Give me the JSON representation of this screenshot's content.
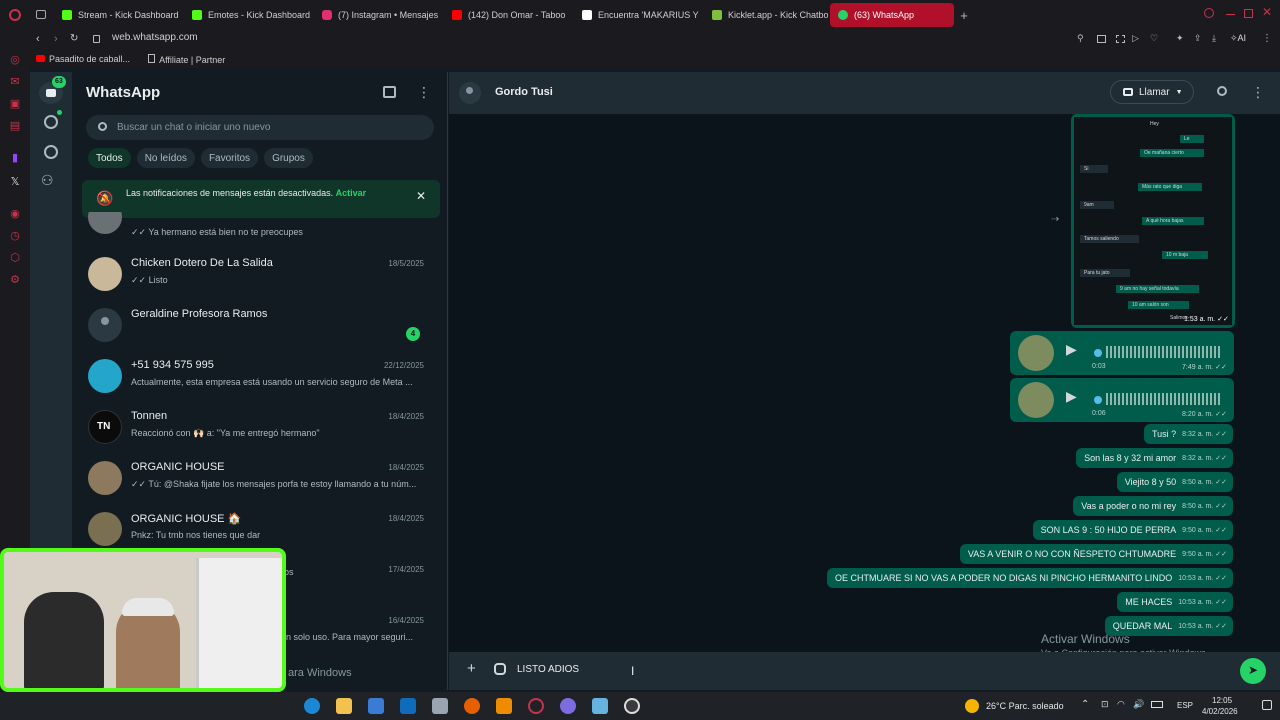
{
  "browser": {
    "tabs": [
      {
        "label": "Stream - Kick Dashboard",
        "color": "#53fc18"
      },
      {
        "label": "Emotes - Kick Dashboard",
        "color": "#53fc18"
      },
      {
        "label": "(7) Instagram • Mensajes",
        "color": "#e1306c"
      },
      {
        "label": "(142) Don Omar - Taboo",
        "color": "#ff0000"
      },
      {
        "label": "Encuentra 'MAKARIUS Y",
        "color": "#ffffff"
      },
      {
        "label": "Kicklet.app - Kick Chatbo",
        "color": "#7fbf3f"
      },
      {
        "label": "(63) WhatsApp",
        "color": "#25d366"
      }
    ],
    "url": "web.whatsapp.com",
    "bookmarks": [
      "Pasadito de caball...",
      "Affiliate | Partner"
    ],
    "ai_label": "AI"
  },
  "whatsapp": {
    "rail": {
      "chats_badge": "63"
    },
    "title": "WhatsApp",
    "search_placeholder": "Buscar un chat o iniciar uno nuevo",
    "filters": [
      "Todos",
      "No leídos",
      "Favoritos",
      "Grupos"
    ],
    "notice": {
      "text": "Las notificaciones de mensajes están desactivadas.",
      "action": "Activar"
    },
    "chats": [
      {
        "name": "",
        "msg": "✓✓ Ya hermano está bien no te preocupes",
        "date": ""
      },
      {
        "name": "Chicken Dotero De La Salida",
        "msg": "✓✓ Listo",
        "date": "18/5/2025"
      },
      {
        "name": "Geraldine Profesora Ramos",
        "msg": "",
        "date": "",
        "unread": "4"
      },
      {
        "name": "+51 934 575 995",
        "msg": "Actualmente, esta empresa está usando un servicio seguro de Meta ...",
        "date": "22/12/2025"
      },
      {
        "name": "Tonnen",
        "msg": "Reaccionó con 🙌🏻 a: \"Ya me entregó hermano\"",
        "date": "18/4/2025"
      },
      {
        "name": "ORGANIC HOUSE",
        "msg": "✓✓ Tú: @Shaka  fijate los mensajes porfa te estoy llamando a tu núm...",
        "date": "18/4/2025"
      },
      {
        "name": "ORGANIC HOUSE 🏠",
        "msg": "Pnkz: Tu tmb nos tienes que dar",
        "date": "18/4/2025"
      },
      {
        "name": "",
        "msg": "os",
        "date": "17/4/2025"
      },
      {
        "name": "",
        "msg": "n solo uso. Para mayor seguri...",
        "date": "16/4/2025"
      }
    ],
    "chat": {
      "contact": "Gordo Tusi",
      "call_label": "Llamar",
      "image_caption_time": "1:53 a. m.",
      "screenshot_lines": [
        "Hey",
        "Le",
        "Oe mañana cierto",
        "Si",
        "Más rato que diga",
        "9am",
        "A qué hora bajas",
        "Tamos saliendo",
        "10 m baja",
        "Para tu jato",
        "9 am no hay señal todavía",
        "10 am salón son",
        "Salimos"
      ],
      "audios": [
        {
          "duration": "0:03",
          "time": "7:49 a. m."
        },
        {
          "duration": "0:06",
          "time": "8:20 a. m."
        }
      ],
      "messages": [
        {
          "text": "Tusi ?",
          "time": "8:32 a. m."
        },
        {
          "text": "Son las 8 y 32 mi amor",
          "time": "8:32 a. m."
        },
        {
          "text": "Viejito 8 y 50",
          "time": "8:50 a. m."
        },
        {
          "text": "Vas a poder o no mi rey",
          "time": "8:50 a. m."
        },
        {
          "text": "SON LAS 9 : 50 HIJO DE PERRA",
          "time": "9:50 a. m."
        },
        {
          "text": "VAS A VENIR O NO CON ÑESPETO CHTUMADRE",
          "time": "9:50 a. m."
        },
        {
          "text": "OE CHTMUARE SI NO VAS A PODER NO DIGAS NI PINCHO HERMANITO LINDO",
          "time": "10:53 a. m."
        },
        {
          "text": "ME HACES",
          "time": "10:53 a. m."
        },
        {
          "text": "QUEDAR MAL",
          "time": "10:53 a. m."
        }
      ],
      "composer_value": "LISTO ADIOS",
      "watermark_title": "Activar Windows",
      "watermark_sub": "Ve a Configuración para activar Windows.",
      "watermark_partial": "ara Windows"
    }
  },
  "taskbar": {
    "weather": "26°C  Parc. soleado",
    "lang": "ESP",
    "time": "12:05",
    "date": "4/02/2026"
  }
}
